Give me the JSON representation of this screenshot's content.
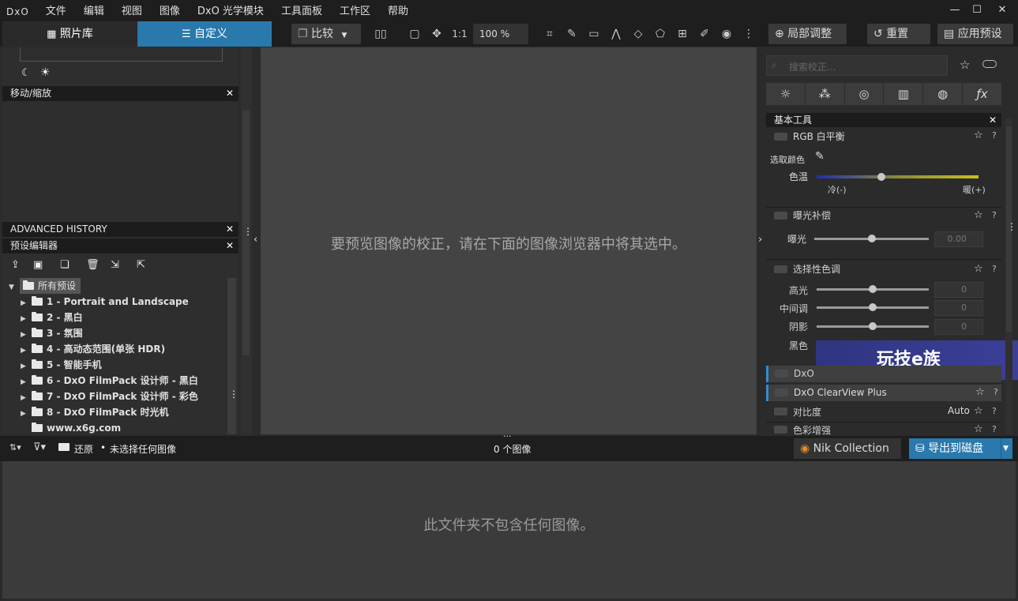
{
  "app": {
    "logo": "DxO"
  },
  "menu": [
    "文件",
    "编辑",
    "视图",
    "图像",
    "DxO 光学模块",
    "工具面板",
    "工作区",
    "帮助"
  ],
  "window_controls": {
    "minimize": "—",
    "maximize": "☐",
    "close": "✕"
  },
  "tabs": {
    "library": "照片库",
    "customize": "自定义"
  },
  "toolbar": {
    "compare": "比较",
    "ratio": "1:1",
    "zoom": "100 %",
    "local_adjust": "局部调整",
    "reset": "重置",
    "apply_preset": "应用预设"
  },
  "left": {
    "move_zoom": "移动/缩放",
    "advanced_history": "ADVANCED HISTORY",
    "preset_editor": "预设编辑器",
    "root_folder": "所有预设",
    "presets": [
      "1 - Portrait and Landscape",
      "2 - 黑白",
      "3 - 氛围",
      "4 - 高动态范围(单张 HDR)",
      "5 - 智能手机",
      "6 - DxO FilmPack 设计师 - 黑白",
      "7 - DxO FilmPack 设计师 - 彩色",
      "8 - DxO FilmPack 时光机"
    ],
    "extra_folder": "www.x6g.com"
  },
  "center": {
    "message": "要预览图像的校正，请在下面的图像浏览器中将其选中。"
  },
  "right": {
    "search_placeholder": "搜索校正...",
    "basic_tools": "基本工具",
    "rgb_wb": "RGB 白平衡",
    "pick_color": "选取颜色",
    "temperature": "色温",
    "cold": "冷(-)",
    "warm": "暖(+)",
    "exposure_comp": "曝光补偿",
    "exposure": "曝光",
    "exposure_value": "0.00",
    "selective_tone": "选择性色调",
    "highlights": "高光",
    "midtones": "中间调",
    "shadows": "阴影",
    "blacks": "黑色",
    "tone_value": "0",
    "dxo_item": "DxO",
    "clearview": "DxO ClearView Plus",
    "contrast": "对比度",
    "contrast_mode": "Auto",
    "vibrancy": "色彩增强",
    "watermark": "玩技e族"
  },
  "bottom": {
    "folder": "还原",
    "no_selection": "未选择任何图像",
    "count": "0 个图像",
    "nik": "Nik Collection",
    "export": "导出到磁盘"
  },
  "filmstrip": {
    "message": "此文件夹不包含任何图像。"
  }
}
